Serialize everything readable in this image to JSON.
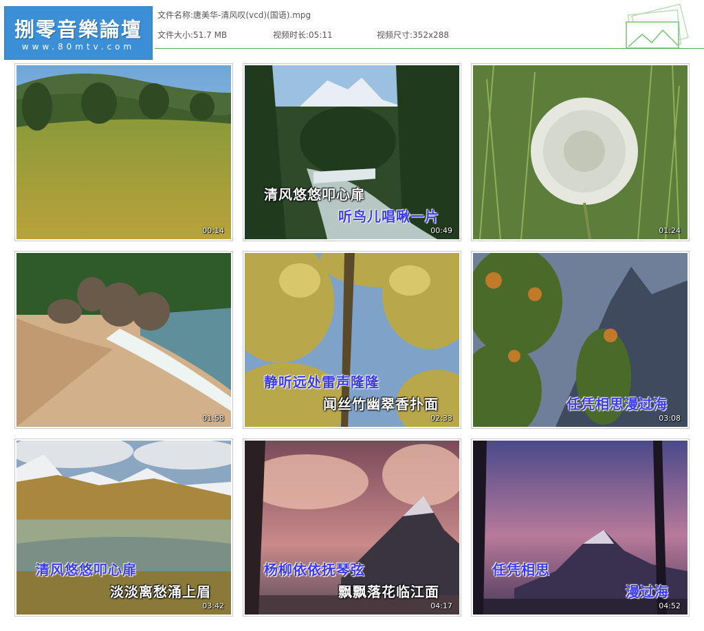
{
  "logo": {
    "main": "捌零音樂論壇",
    "url": "www.80mtv.com"
  },
  "file": {
    "name_label": "文件名称:",
    "name": "唐美华-清风叹(vcd)(国语).mpg",
    "size_label": "文件大小:",
    "size": "51.7 MB",
    "duration_label": "视频时长:",
    "duration": "05:11",
    "dims_label": "视频尺寸:",
    "dims": "352x288"
  },
  "thumbs": [
    {
      "time": "00:14",
      "lyrics": []
    },
    {
      "time": "00:49",
      "lyrics": [
        "清风悠悠叩心扉",
        "听鸟儿唱啾一片"
      ]
    },
    {
      "time": "01:24",
      "lyrics": []
    },
    {
      "time": "01:58",
      "lyrics": []
    },
    {
      "time": "02:33",
      "lyrics": [
        "静听远处雷声隆隆",
        "闻丝竹幽翠香扑面"
      ]
    },
    {
      "time": "03:08",
      "lyrics": [
        "任凭相思漫过海"
      ]
    },
    {
      "time": "03:42",
      "lyrics": [
        "清风悠悠叩心扉",
        "淡淡离愁涌上眉"
      ]
    },
    {
      "time": "04:17",
      "lyrics": [
        "杨柳依依抚琴弦",
        "飘飘落花临江面"
      ]
    },
    {
      "time": "04:52",
      "lyrics": [
        "任凭相思",
        "漫过海"
      ]
    }
  ]
}
